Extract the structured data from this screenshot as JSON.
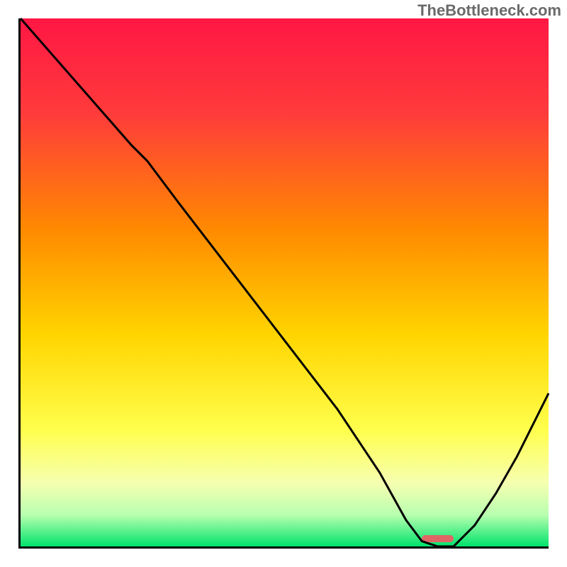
{
  "watermark": "TheBottleneck.com",
  "chart_data": {
    "type": "line",
    "title": "",
    "xlabel": "",
    "ylabel": "",
    "xlim": [
      0,
      100
    ],
    "ylim": [
      0,
      100
    ],
    "gradient": [
      {
        "stop": 0,
        "color": "#ff1744"
      },
      {
        "stop": 18,
        "color": "#ff3b3b"
      },
      {
        "stop": 40,
        "color": "#ff8a00"
      },
      {
        "stop": 60,
        "color": "#ffd500"
      },
      {
        "stop": 78,
        "color": "#ffff4d"
      },
      {
        "stop": 88,
        "color": "#f6ffb0"
      },
      {
        "stop": 94,
        "color": "#b9ffb0"
      },
      {
        "stop": 100,
        "color": "#00e36c"
      }
    ],
    "series": [
      {
        "name": "bottleneck-curve",
        "color": "#000000",
        "width": 3,
        "x": [
          0,
          7,
          14,
          21,
          24,
          30,
          40,
          50,
          60,
          68,
          73,
          76,
          79,
          82,
          86,
          90,
          94,
          100
        ],
        "y": [
          100,
          92,
          84,
          76,
          73,
          65,
          52,
          39,
          26,
          14,
          5,
          1,
          0,
          0,
          4,
          10,
          17,
          29
        ]
      }
    ],
    "marker": {
      "x_center": 79,
      "width_pct": 6,
      "y": 0.8,
      "color": "#e06666"
    }
  }
}
